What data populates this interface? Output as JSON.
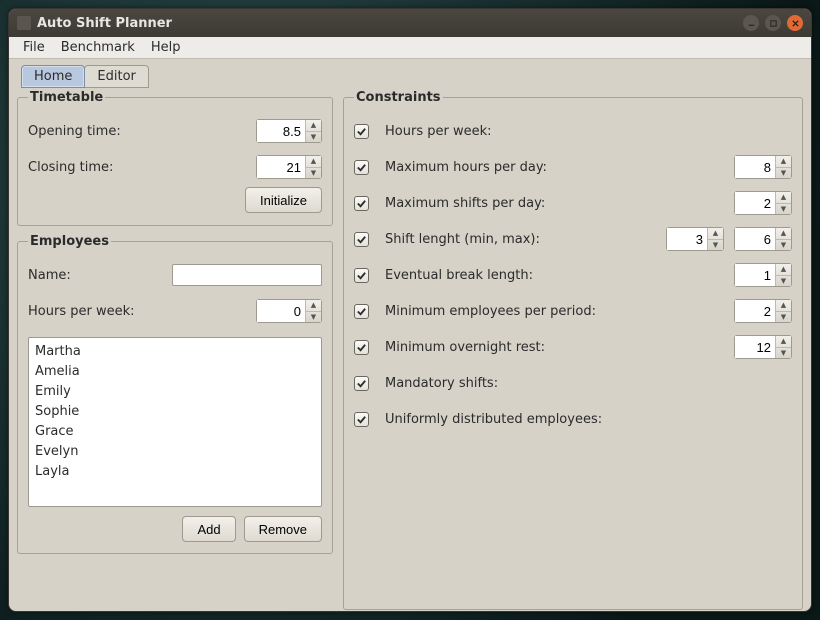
{
  "window": {
    "title": "Auto Shift Planner"
  },
  "menubar": [
    "File",
    "Benchmark",
    "Help"
  ],
  "tabs": {
    "items": [
      "Home",
      "Editor"
    ],
    "active": 0
  },
  "timetable": {
    "legend": "Timetable",
    "opening_label": "Opening time:",
    "opening_value": "8.5",
    "closing_label": "Closing time:",
    "closing_value": "21",
    "initialize_label": "Initialize"
  },
  "employees": {
    "legend": "Employees",
    "name_label": "Name:",
    "name_value": "",
    "hours_label": "Hours per week:",
    "hours_value": "0",
    "list": [
      "Martha",
      "Amelia",
      "Emily",
      "Sophie",
      "Grace",
      "Evelyn",
      "Layla"
    ],
    "add_label": "Add",
    "remove_label": "Remove"
  },
  "constraints": {
    "legend": "Constraints",
    "rows": {
      "hours_per_week": {
        "label": "Hours per week:",
        "checked": true
      },
      "max_hours_day": {
        "label": "Maximum hours per day:",
        "checked": true,
        "value": "8"
      },
      "max_shifts_day": {
        "label": "Maximum shifts per day:",
        "checked": true,
        "value": "2"
      },
      "shift_length": {
        "label": "Shift lenght (min, max):",
        "checked": true,
        "min": "3",
        "max": "6"
      },
      "break_length": {
        "label": "Eventual break length:",
        "checked": true,
        "value": "1"
      },
      "min_emp_period": {
        "label": "Minimum employees per period:",
        "checked": true,
        "value": "2"
      },
      "min_overnight": {
        "label": "Minimum overnight rest:",
        "checked": true,
        "value": "12"
      },
      "mandatory_shifts": {
        "label": "Mandatory shifts:",
        "checked": true
      },
      "uniform_dist": {
        "label": "Uniformly distributed employees:",
        "checked": true
      }
    }
  }
}
